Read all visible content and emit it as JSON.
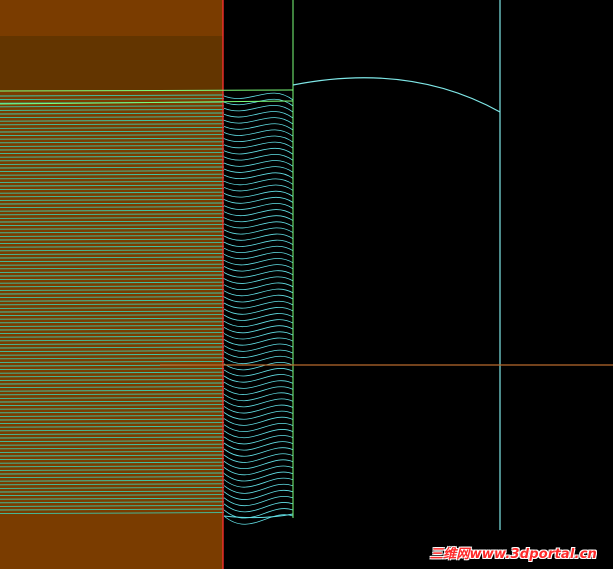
{
  "viewport": {
    "background": "#000000"
  },
  "colors": {
    "brown_block": "#7a3c00",
    "brown_dark_band": "#633500",
    "hatch_green": "#3fc7a7",
    "hatch_cyan": "#62e0e6",
    "green_axis": "#7cff7a",
    "cyan_curve": "#7fe7e7",
    "orange_axis": "#b86a2c",
    "red_edge": "#ff3030"
  },
  "watermark": {
    "text": "三维网www.3dportal.cn",
    "color": "#ff2a2a"
  }
}
